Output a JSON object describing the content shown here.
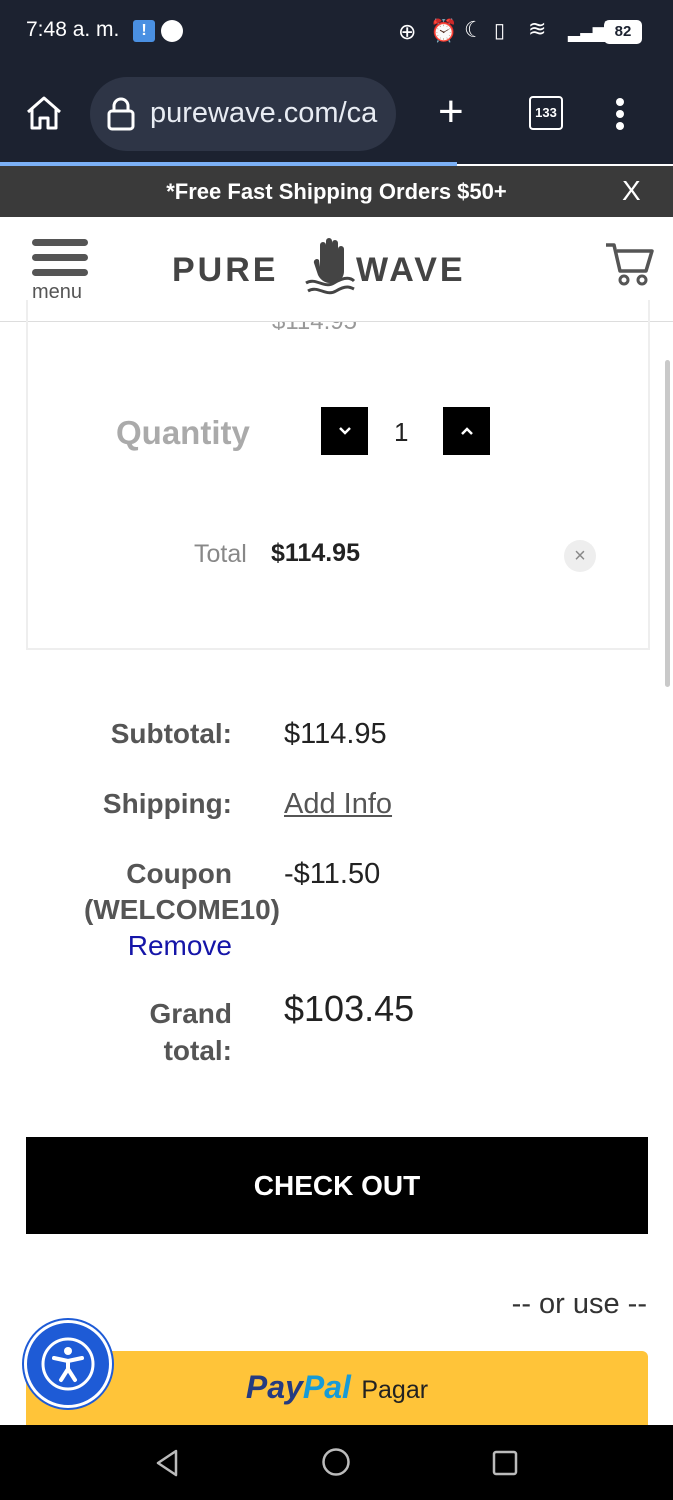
{
  "status": {
    "time": "7:48 a. m.",
    "battery": "82"
  },
  "browser": {
    "url": "purewave.com/ca",
    "tab_count": "133"
  },
  "promo": {
    "text": "*Free Fast Shipping Orders $50+",
    "close": "X"
  },
  "header": {
    "menu_label": "menu",
    "logo_left": "PURE",
    "logo_right": "WAVE"
  },
  "cart_item": {
    "price_partial": "$114.95",
    "quantity_label": "Quantity",
    "quantity": "1",
    "total_label": "Total",
    "total_value": "$114.95"
  },
  "summary": {
    "subtotal_label": "Subtotal:",
    "subtotal_value": "$114.95",
    "shipping_label": "Shipping:",
    "shipping_value": "Add Info",
    "coupon_label": "Coupon",
    "coupon_code": "(WELCOME10)",
    "coupon_remove": "Remove",
    "coupon_value": "-$11.50",
    "grand_label_1": "Grand",
    "grand_label_2": "total:",
    "grand_value": "$103.45"
  },
  "checkout_label": "CHECK OUT",
  "or_use": "-- or use --",
  "paypal": {
    "pay": "Pay",
    "pal": "Pal",
    "label": "Pagar"
  },
  "colors": {
    "remove_link": "#1515a8",
    "paypal_bg": "#ffc439",
    "a11y_blue": "#1e5bd6"
  }
}
